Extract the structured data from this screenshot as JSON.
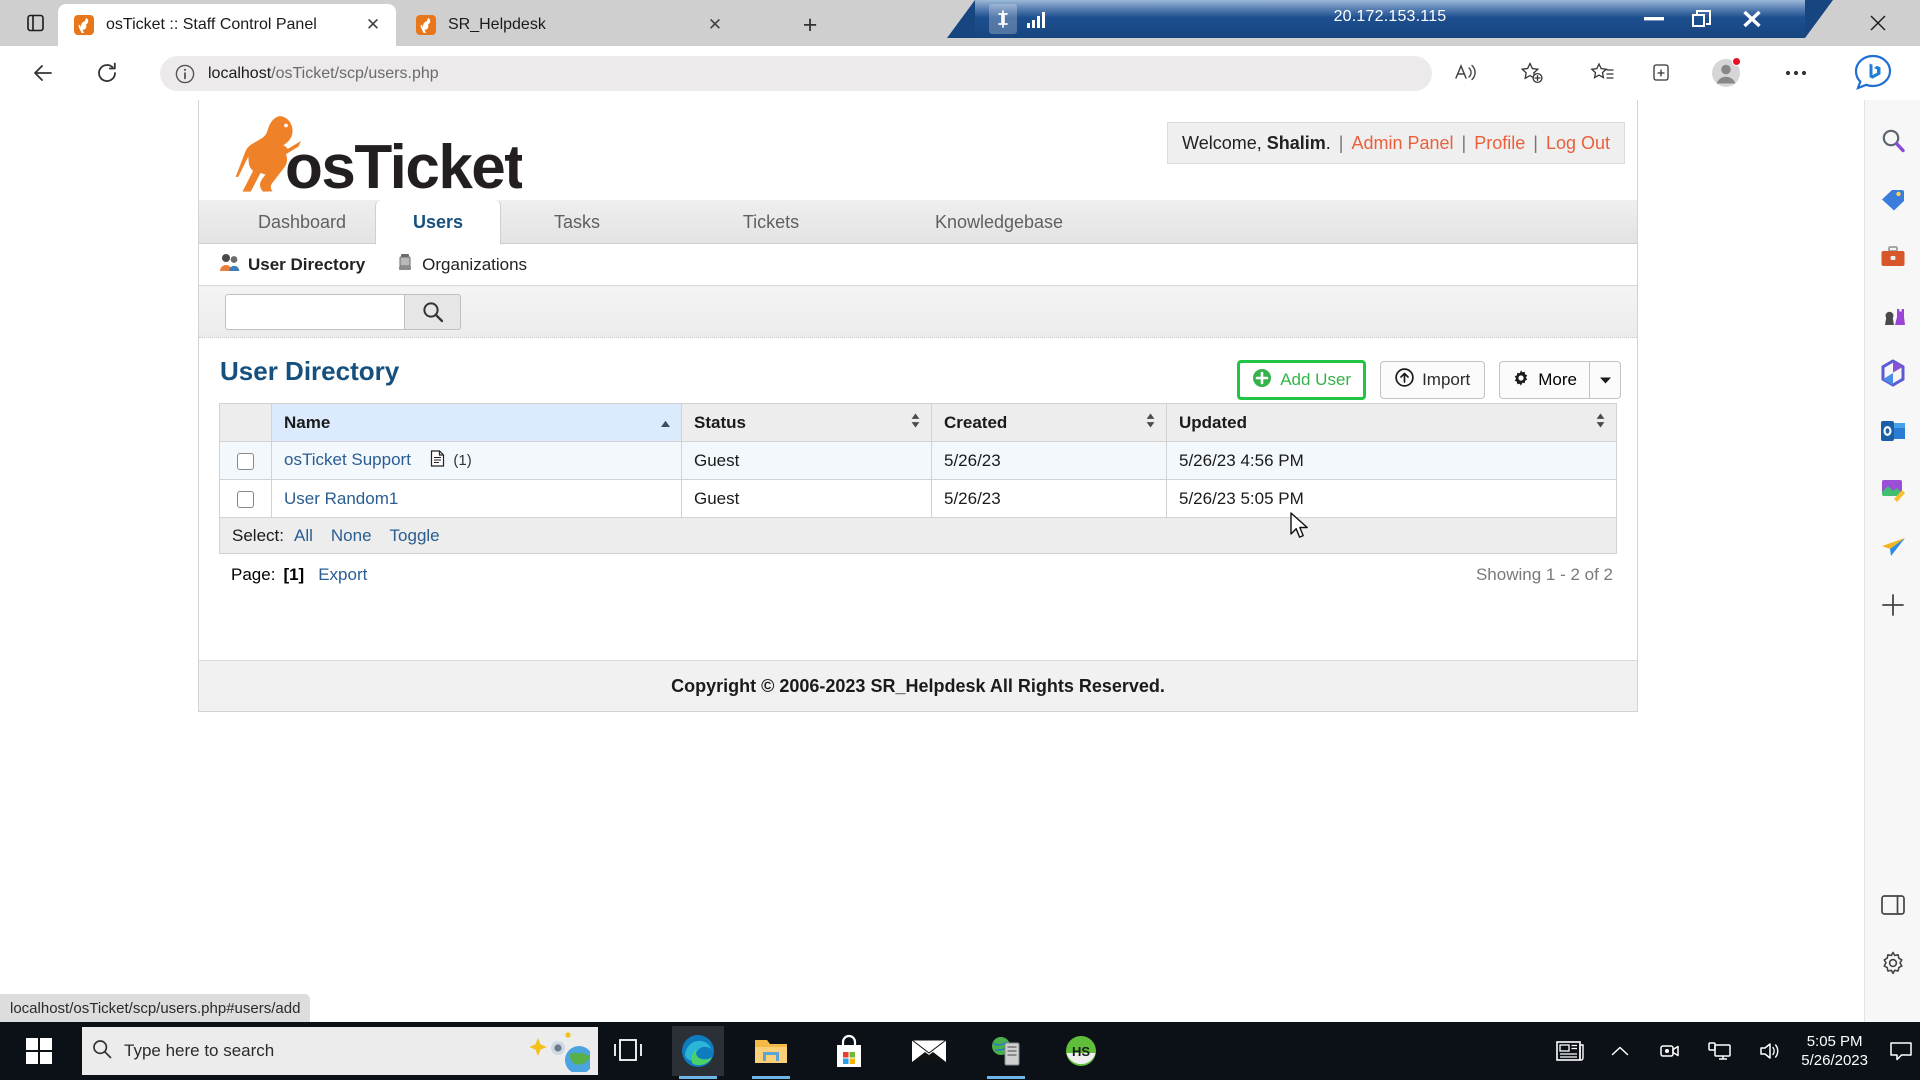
{
  "rdp": {
    "ip": "20.172.153.115",
    "pin_icon": "pin-icon",
    "signal_icon": "signal-strength-icon",
    "minimize_icon": "minimize-icon",
    "restore_icon": "restore-icon",
    "close_icon": "close-icon"
  },
  "browser": {
    "tabs": [
      {
        "title": "osTicket :: Staff Control Panel",
        "active": true,
        "close_label": "✕"
      },
      {
        "title": "SR_Helpdesk",
        "active": false,
        "close_label": "✕"
      }
    ],
    "new_tab_label": "+",
    "url_host": "localhost",
    "url_path": "/osTicket/scp/users.php",
    "url_full": "localhost/osTicket/scp/users.php",
    "back_icon": "back-arrow-icon",
    "reload_icon": "reload-icon",
    "info_icon": "info-circle-icon",
    "tab_search_icon": "tab-search-icon",
    "window_restore_icon": "restore-icon",
    "window_close_icon": "close-icon",
    "toolbar_icons": [
      "read-aloud-icon",
      "add-favorite-icon",
      "favorites-icon",
      "collections-icon",
      "profile-avatar-icon",
      "settings-more-icon",
      "copilot-bing-icon"
    ],
    "status_bar_url": "localhost/osTicket/scp/users.php#users/add"
  },
  "edge_sidebar": {
    "items": [
      {
        "icon": "search-icon"
      },
      {
        "icon": "shopping-tag-icon"
      },
      {
        "icon": "tools-briefcase-icon"
      },
      {
        "icon": "games-chess-icon"
      },
      {
        "icon": "microsoft-365-icon"
      },
      {
        "icon": "outlook-icon"
      },
      {
        "icon": "image-editor-icon"
      },
      {
        "icon": "drop-paperplane-icon"
      },
      {
        "icon": "add-sidebar-icon"
      }
    ],
    "bottom": [
      {
        "icon": "sidebar-toggle-icon"
      },
      {
        "icon": "gear-icon"
      }
    ]
  },
  "osticket": {
    "logo_alt": "osTicket",
    "welcome": {
      "prefix": "Welcome,",
      "user": "Shalim",
      "suffix": ".",
      "links": [
        "Admin Panel",
        "Profile",
        "Log Out"
      ],
      "link_color": "#e8603c"
    },
    "nav_tabs": [
      {
        "label": "Dashboard",
        "active": false
      },
      {
        "label": "Users",
        "active": true
      },
      {
        "label": "Tasks",
        "active": false
      },
      {
        "label": "Tickets",
        "active": false
      },
      {
        "label": "Knowledgebase",
        "active": false
      }
    ],
    "subnav": [
      {
        "label": "User Directory",
        "active": true,
        "icon": "users-group-icon"
      },
      {
        "label": "Organizations",
        "active": false,
        "icon": "organization-icon"
      }
    ],
    "search": {
      "value": "",
      "placeholder": "",
      "icon": "search-icon"
    },
    "page_title": "User Directory",
    "actions": {
      "add_user": {
        "label": "Add User",
        "icon": "plus-circle-icon",
        "highlighted": true,
        "highlight_color": "#22c543"
      },
      "import": {
        "label": "Import",
        "icon": "import-arrow-icon"
      },
      "more": {
        "label": "More",
        "icon": "gear-icon",
        "caret": "▼"
      }
    },
    "table": {
      "columns": [
        {
          "label": "Name",
          "sorted": true,
          "sort_dir": "asc"
        },
        {
          "label": "Status",
          "sorted": false,
          "sort_dir": "none"
        },
        {
          "label": "Created",
          "sorted": false,
          "sort_dir": "none"
        },
        {
          "label": "Updated",
          "sorted": false,
          "sort_dir": "none"
        }
      ],
      "rows": [
        {
          "name": "osTicket Support",
          "ticket_icon": "document-icon",
          "ticket_count": "(1)",
          "status": "Guest",
          "created": "5/26/23",
          "updated": "5/26/23 4:56 PM",
          "checked": false
        },
        {
          "name": "User Random1",
          "ticket_icon": "",
          "ticket_count": "",
          "status": "Guest",
          "created": "5/26/23",
          "updated": "5/26/23 5:05 PM",
          "checked": false
        }
      ]
    },
    "select_bar": {
      "label": "Select:",
      "options": [
        "All",
        "None",
        "Toggle"
      ]
    },
    "pagination": {
      "label": "Page:",
      "current": "[1]",
      "export_label": "Export",
      "showing": "Showing 1 - 2 of 2"
    },
    "copyright": "Copyright © 2006-2023 SR_Helpdesk All Rights Reserved."
  },
  "taskbar": {
    "start_icon": "windows-start-icon",
    "search_placeholder": "Type here to search",
    "search_icon": "search-icon",
    "cortana_icon": "cortana-sparkle-icon",
    "taskview_icon": "task-view-icon",
    "apps": [
      {
        "name": "microsoft-edge",
        "active": true
      },
      {
        "name": "file-explorer",
        "active": false
      },
      {
        "name": "microsoft-store",
        "active": false
      },
      {
        "name": "mail",
        "active": false
      },
      {
        "name": "iis-manager",
        "active": false
      },
      {
        "name": "heidisql",
        "active": false,
        "label": "HS"
      }
    ],
    "tray": [
      {
        "icon": "news-weather-icon"
      },
      {
        "icon": "chevron-up-icon"
      },
      {
        "icon": "camera-recording-icon"
      },
      {
        "icon": "network-icon"
      },
      {
        "icon": "volume-icon"
      }
    ],
    "clock_time": "5:05 PM",
    "clock_date": "5/26/2023",
    "notification_icon": "notification-icon"
  }
}
